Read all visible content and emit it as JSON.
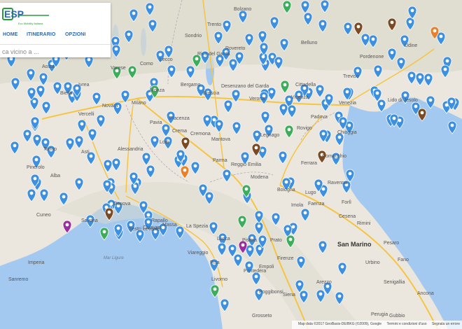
{
  "header": {
    "logo_text": "ESP",
    "logo_subtitle": "Ecc Mobility Italiana",
    "nav": [
      "HOME",
      "ITINERARIO",
      "OPZIONI"
    ],
    "search_placeholder": "ca vicino a ..."
  },
  "map": {
    "featured_label": "San Marino",
    "city_labels": [
      "Milano",
      "Monza",
      "Bergamo",
      "Brescia",
      "Verona",
      "Vicenza",
      "Padova",
      "Venezia",
      "Treviso",
      "Pordenone",
      "Udine",
      "Trento",
      "Novara",
      "Vercelli",
      "Pavia",
      "Alessandria",
      "Asti",
      "Piacenza",
      "Cremona",
      "Parma",
      "Reggio Emilia",
      "Modena",
      "Bologna",
      "Ferrara",
      "Ravenna",
      "Forlì",
      "Cesena",
      "Rimini",
      "Pesaro",
      "Genova",
      "Savona",
      "La Spezia",
      "Massa",
      "Lucca",
      "Pisa",
      "Livorno",
      "Firenze",
      "Prato",
      "Pistoia",
      "Arezzo",
      "Siena",
      "Grosseto",
      "Viareggio",
      "Mantova",
      "Rovigo",
      "Lido di Jesolo",
      "Senigallia",
      "Ancona",
      "Fano",
      "Urbino",
      "Perugia",
      "Sanremo",
      "Imperia",
      "Alba",
      "Cuneo",
      "Pinerolo",
      "Torino",
      "Biella",
      "Ivrea",
      "Aosta",
      "Como",
      "Lecco",
      "Varese",
      "Sondrio",
      "Belluno",
      "Rovereto",
      "Riva del Garda",
      "Bolzano",
      "Cittadella",
      "Chioggia",
      "Gubbio",
      "Sestri Levante",
      "Chiavari",
      "Rapallo",
      "Pontedera",
      "Empoli",
      "Poggibonsi",
      "Lugo",
      "Imola",
      "Faenza",
      "Comacchio",
      "Legnago",
      "Desenzano del Garda",
      "Lodi",
      "Crema"
    ],
    "sea_labels": [
      "Mar Ligure"
    ],
    "attribution": [
      "Map data ©2017 GeoBasis-DE/BKG (©2009), Google",
      "Termini e condizioni d'uso",
      "Segnala un errore"
    ],
    "marker_colors": {
      "blue": "#3d8fe0",
      "green": "#3cae5b",
      "brown": "#7b4a22",
      "orange": "#e8822a",
      "purple": "#9b2da0"
    },
    "counts": {
      "blue": 210,
      "green": 12,
      "brown": 7,
      "orange": 2,
      "purple": 2
    }
  }
}
